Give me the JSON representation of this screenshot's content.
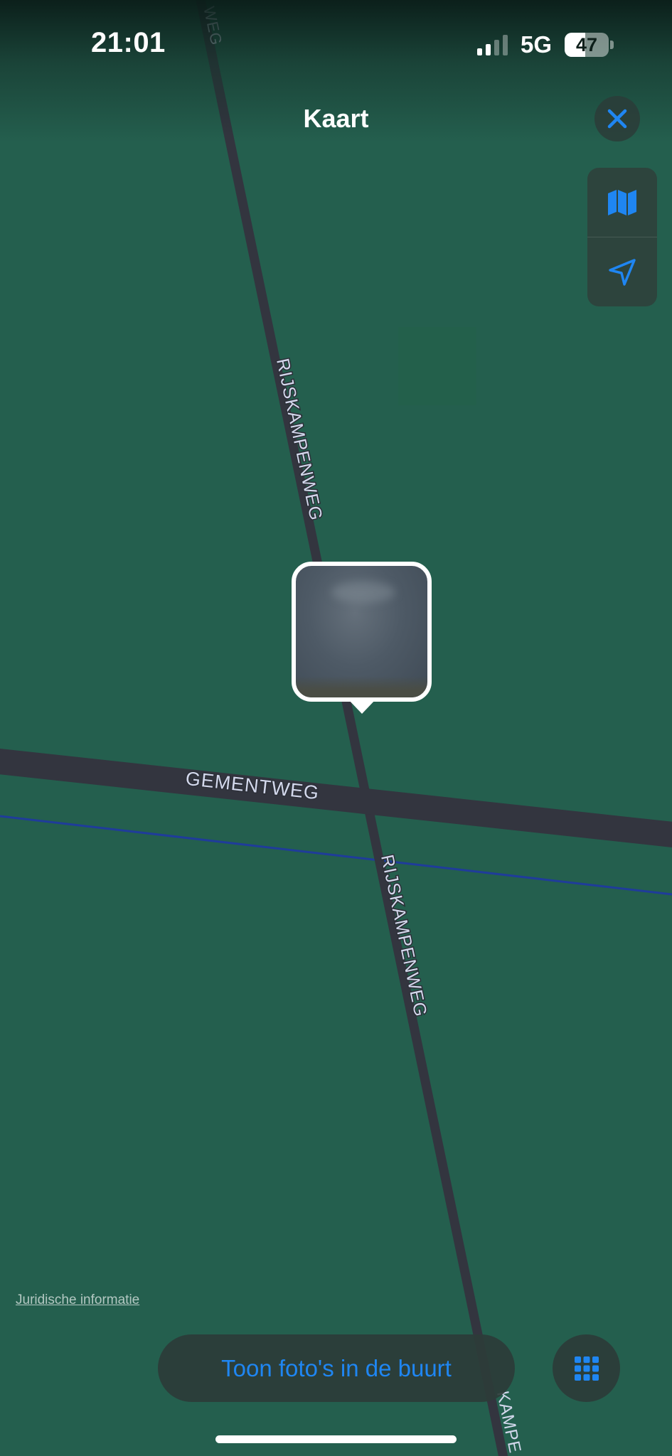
{
  "status_bar": {
    "time": "21:01",
    "network": "5G",
    "battery_percent": "47",
    "signal_bars_active": 2,
    "signal_bars_total": 4
  },
  "nav": {
    "title": "Kaart",
    "close_icon": "close-icon"
  },
  "map_controls": {
    "map_mode_icon": "map-icon",
    "location_icon": "location-arrow-icon"
  },
  "roads": {
    "top_partial": "WEG",
    "rijskampenweg_upper": "RIJSKAMPENWEG",
    "gementweg": "GEMENTWEG",
    "rijskampenweg_lower": "RIJSKAMPENWEG",
    "bottom_partial": "KAMPE"
  },
  "legal_link": "Juridische informatie",
  "bottom_bar": {
    "nearby_button": "Toon foto's in de buurt",
    "grid_icon": "grid-icon"
  },
  "colors": {
    "map_background": "#245f4e",
    "road": "#33353f",
    "road_label": "#d3d8ec",
    "rail_line": "#1f3c9a",
    "accent": "#1f86f2"
  }
}
